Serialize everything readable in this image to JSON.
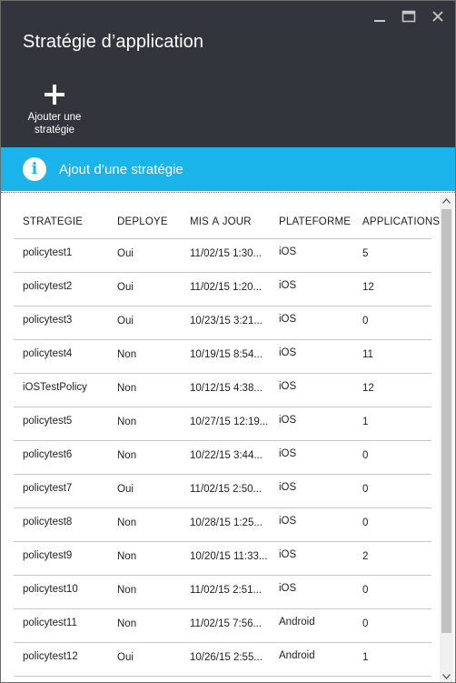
{
  "blade": {
    "title": "Stratégie d’application"
  },
  "commands": {
    "add_label": "Ajouter une\nstratégie"
  },
  "info_bar": {
    "text": "Ajout d’une stratégie"
  },
  "grid": {
    "columns": [
      "STRATÉGIE",
      "DÉPLOYÉ",
      "MIS À JOUR",
      "PLATEFORME",
      "APPLICATIONS"
    ],
    "rows": [
      {
        "name": "policytest1",
        "deployed": "Oui",
        "updated": "11/02/15 1:30...",
        "platform": "iOS",
        "apps": "5"
      },
      {
        "name": "policytest2",
        "deployed": "Oui",
        "updated": "11/02/15 1:20...",
        "platform": "iOS",
        "apps": "12"
      },
      {
        "name": "policytest3",
        "deployed": "Oui",
        "updated": "10/23/15 3:21...",
        "platform": "iOS",
        "apps": "0"
      },
      {
        "name": "policytest4",
        "deployed": "Non",
        "updated": "10/19/15 8:54...",
        "platform": "iOS",
        "apps": "11"
      },
      {
        "name": "iOSTestPolicy",
        "deployed": "Non",
        "updated": "10/12/15 4:38...",
        "platform": "iOS",
        "apps": "12"
      },
      {
        "name": "policytest5",
        "deployed": "Non",
        "updated": "10/27/15 12:19...",
        "platform": "iOS",
        "apps": "1"
      },
      {
        "name": "policytest6",
        "deployed": "Non",
        "updated": "10/22/15 3:44...",
        "platform": "iOS",
        "apps": "0"
      },
      {
        "name": "policytest7",
        "deployed": "Oui",
        "updated": "11/02/15 2:50...",
        "platform": "iOS",
        "apps": "0"
      },
      {
        "name": "policytest8",
        "deployed": "Non",
        "updated": "10/28/15 1:25...",
        "platform": "iOS",
        "apps": "0"
      },
      {
        "name": "policytest9",
        "deployed": "Non",
        "updated": "10/20/15 11:33...",
        "platform": "iOS",
        "apps": "2"
      },
      {
        "name": "policytest10",
        "deployed": "Non",
        "updated": "11/02/15 2:51...",
        "platform": "iOS",
        "apps": "0"
      },
      {
        "name": "policytest11",
        "deployed": "Non",
        "updated": "11/02/15 7:56...",
        "platform": "Android",
        "apps": "0"
      },
      {
        "name": "policytest12",
        "deployed": "Oui",
        "updated": "10/26/15 2:55...",
        "platform": "Android",
        "apps": "1"
      }
    ]
  },
  "colors": {
    "header_bg": "#32363c",
    "info_bar_bg": "#1ab4ea",
    "row_divider": "#c8c8c8"
  },
  "icons": {
    "minimize": "minimize-icon",
    "maximize": "maximize-icon",
    "close": "close-icon",
    "add": "plus-icon",
    "info": "info-icon"
  }
}
